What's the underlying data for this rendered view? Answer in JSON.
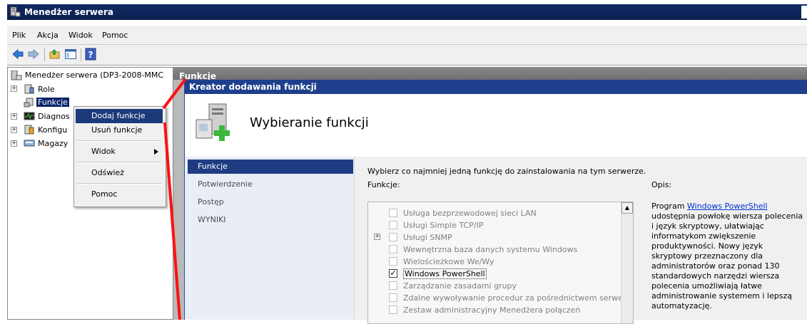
{
  "window": {
    "title": "Menedżer serwera"
  },
  "menu": [
    "Plik",
    "Akcja",
    "Widok",
    "Pomoc"
  ],
  "toolbar": [
    "back-icon",
    "forward-icon",
    "up-folder-icon",
    "console-tree-icon",
    "help-icon"
  ],
  "tree": {
    "root": "Menedżer serwera (DP3-2008-MMC",
    "items": [
      "Role",
      "Funkcje",
      "Diagnos",
      "Konfigu",
      "Magazy"
    ]
  },
  "context_menu": {
    "items": [
      "Dodaj funkcje",
      "Usuń funkcje",
      "Widok",
      "Odśwież",
      "Pomoc"
    ]
  },
  "right_header": "Funkcje",
  "wizard": {
    "title": "Kreator dodawania funkcji",
    "heading": "Wybieranie funkcji",
    "nav": [
      "Funkcje",
      "Potwierdzenie",
      "Postęp",
      "WYNIKI"
    ],
    "instruction": "Wybierz co najmniej jedną funkcję do zainstalowania na tym serwerze.",
    "features_label": "Funkcje:",
    "description_label": "Opis:",
    "features": [
      {
        "label": "Usługa bezprzewodowej sieci LAN",
        "checked": false
      },
      {
        "label": "Usługi Simple TCP/IP",
        "checked": false
      },
      {
        "label": "Usługi SNMP",
        "checked": false
      },
      {
        "label": "Wewnętrzna baza danych systemu Windows",
        "checked": false
      },
      {
        "label": "Wielościeżkowe We/Wy",
        "checked": false
      },
      {
        "label": "Windows PowerShell",
        "checked": true
      },
      {
        "label": "Zarządzanie zasadami grupy",
        "checked": false
      },
      {
        "label": "Zdalne wywoływanie procedur za pośrednictwem serwera",
        "checked": false
      },
      {
        "label": "Zestaw administracyjny Menedżera połączeń",
        "checked": false
      }
    ],
    "description_prefix": "Program ",
    "description_link": "Windows PowerShell",
    "description_text": "udostępnia powłokę wiersza polecenia i język skryptowy, ułatwiając informatykom zwiększenie produktywności. Nowy język skryptowy przeznaczony dla administratorów oraz ponad 130 standardowych narzędzi wiersza polecenia umożliwiają łatwe administrowanie systemem i lepszą automatyzację.",
    "checkmark": "✓",
    "expander": "+"
  },
  "colors": {
    "selection": "#0a246a",
    "wizard_title": "#1e3f8c",
    "annotation": "#ff1010"
  }
}
